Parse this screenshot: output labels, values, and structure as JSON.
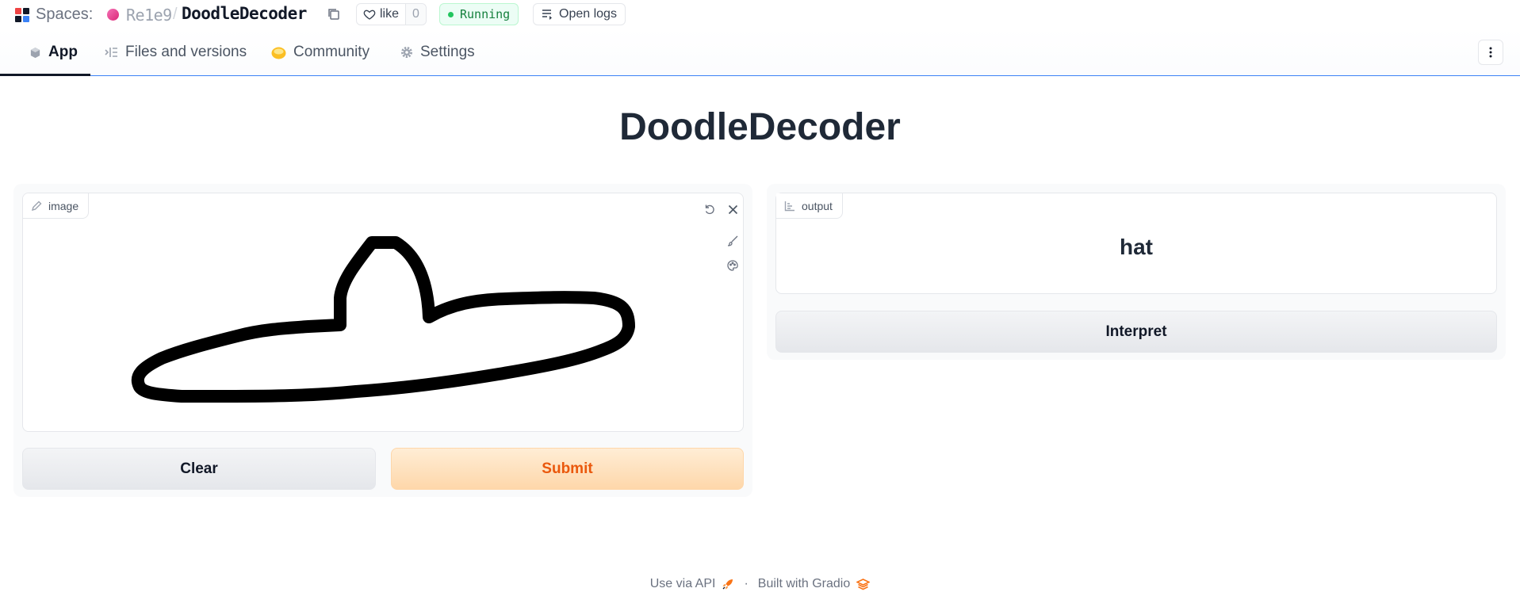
{
  "header": {
    "spaces_label": "Spaces:",
    "owner": "Re1e9",
    "separator": "/",
    "space_name": "DoodleDecoder",
    "like_label": "like",
    "like_count": "0",
    "status": "Running",
    "logs_label": "Open logs"
  },
  "tabs": [
    {
      "label": "App",
      "active": true,
      "icon": "cube-icon"
    },
    {
      "label": "Files and versions",
      "active": false,
      "icon": "files-icon"
    },
    {
      "label": "Community",
      "active": false,
      "icon": "community-icon"
    },
    {
      "label": "Settings",
      "active": false,
      "icon": "gear-icon"
    }
  ],
  "app": {
    "title": "DoodleDecoder",
    "input": {
      "label": "image",
      "tools": [
        "undo-icon",
        "close-icon",
        "brush-icon",
        "palette-icon"
      ]
    },
    "clear_label": "Clear",
    "submit_label": "Submit",
    "output": {
      "label": "output",
      "value": "hat"
    },
    "interpret_label": "Interpret"
  },
  "footer": {
    "api_label": "Use via API",
    "dot": "·",
    "built_label": "Built with Gradio"
  },
  "colors": {
    "accent_orange": "#ea580c",
    "submit_bg": "#fed7aa",
    "status_green": "#22c55e",
    "tab_border": "#3b82f6"
  }
}
